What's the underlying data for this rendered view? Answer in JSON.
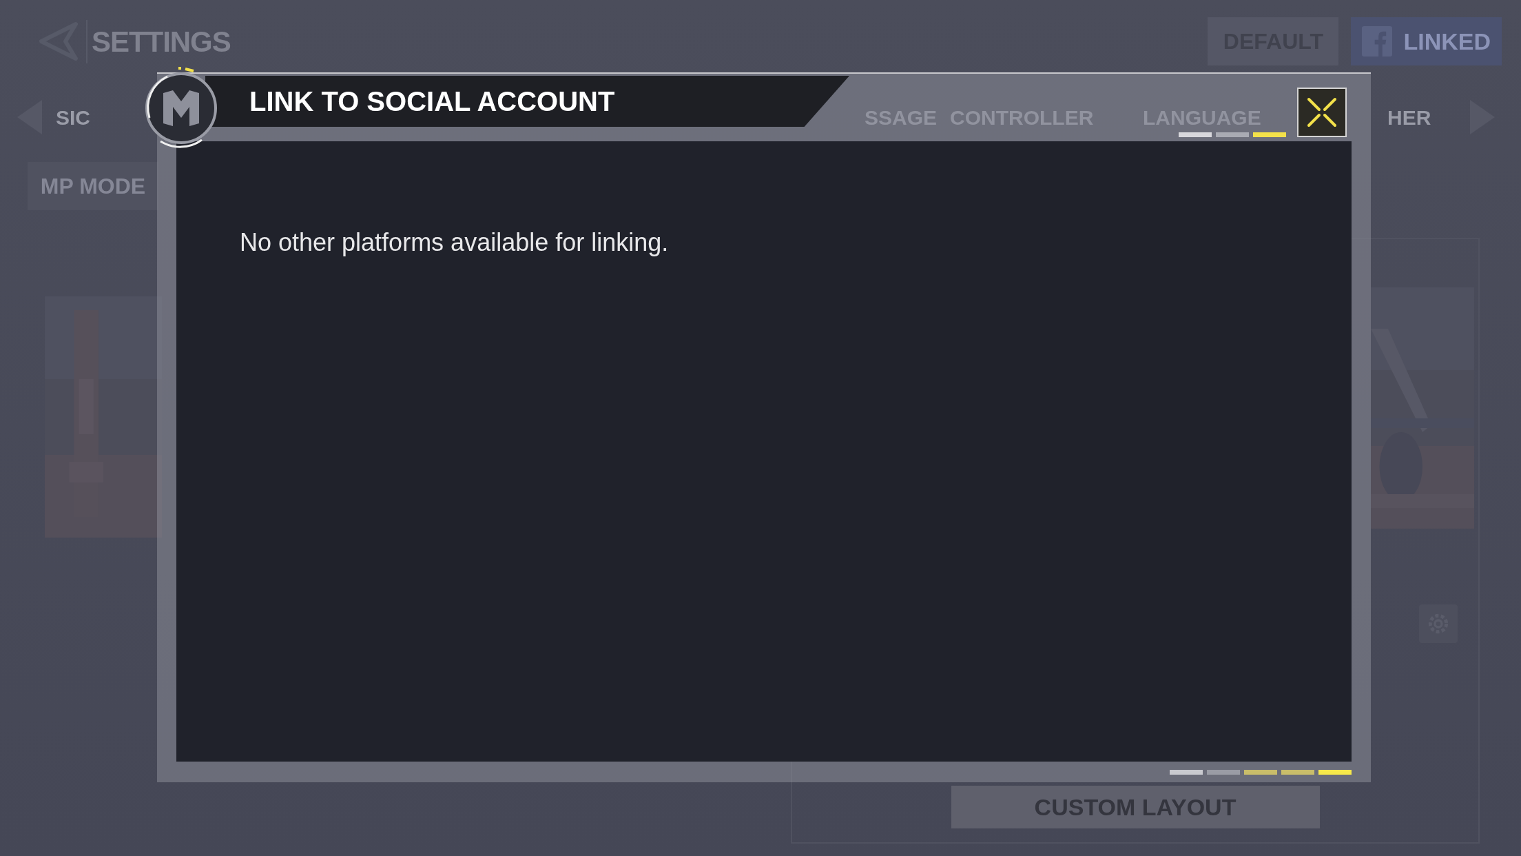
{
  "background": {
    "title": "SETTINGS",
    "buttons": [
      {
        "kind": "default",
        "label": "DEFAULT"
      },
      {
        "kind": "facebook",
        "label": "LINKED"
      }
    ],
    "tabs": [
      "SIC",
      "SSAGE",
      "CONTROLLER",
      "LANGUAGE",
      "HER"
    ],
    "mode_button": "MP MODE",
    "layout_button": "CUSTOM LAYOUT"
  },
  "dialog": {
    "title": "LINK TO SOCIAL ACCOUNT",
    "message": "No other platforms available for linking.",
    "top_indicators": [
      {
        "color": "#d8d8dc"
      },
      {
        "color": "#a9abb3"
      },
      {
        "color": "#f3e14a"
      }
    ],
    "bottom_indicators": [
      {
        "color": "#c9cacf"
      },
      {
        "color": "#9a9ca5"
      },
      {
        "color": "#c9bd6a"
      },
      {
        "color": "#c9bd6a"
      },
      {
        "color": "#f6e84a"
      }
    ]
  }
}
